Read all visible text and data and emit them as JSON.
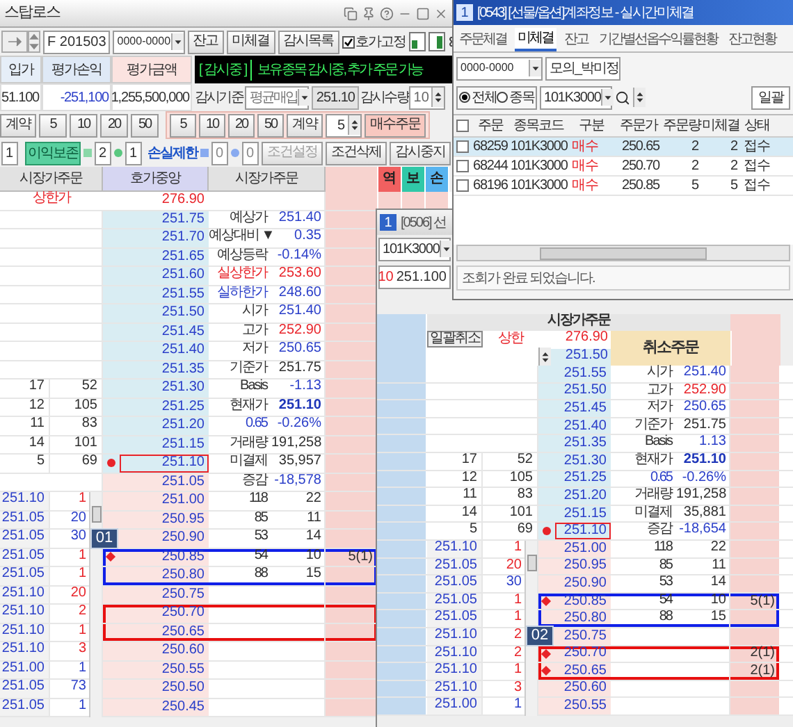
{
  "stoploss": {
    "title": "스탑로스",
    "toolbar": {
      "code": "F 201503",
      "account": "0000-0000",
      "buttons": [
        "잔고",
        "미체결",
        "감시목록"
      ],
      "fix_quote": {
        "label": "호가고정",
        "checked": true
      }
    },
    "summary": {
      "headers": [
        "입가",
        "평가손익",
        "평가금액"
      ],
      "values": [
        "51.100",
        "-251,100",
        "1,255,500,000"
      ],
      "status": "[ 감시중 ]",
      "message": "보유종목 감시중, 추가 주문 가능"
    },
    "watch": {
      "basis_label": "감시기준",
      "basis": "평균매입",
      "price": "251.10",
      "qty_label": "감시수량",
      "qty": "10"
    },
    "quick_left": {
      "label": "계약",
      "values": [
        "5",
        "10",
        "20",
        "50"
      ]
    },
    "quick_right": {
      "values": [
        "5",
        "10",
        "20",
        "50"
      ],
      "label": "계약",
      "qty": "5",
      "order": "매수주문"
    },
    "conditions": {
      "count": "1",
      "profit": {
        "label": "이익보존",
        "values": [
          "2",
          "1"
        ]
      },
      "loss": {
        "label": "손실제한",
        "values": [
          "0",
          "0"
        ]
      },
      "buttons": [
        {
          "label": "조건설정",
          "disabled": true
        },
        {
          "label": "조건삭제",
          "disabled": false
        },
        {
          "label": "감시중지",
          "disabled": false
        }
      ]
    },
    "book": {
      "columns": [
        "시장가주문",
        "호가중앙",
        "시장가주문"
      ],
      "flags": [
        {
          "label": "역",
          "color": "#f06060"
        },
        {
          "label": "보",
          "color": "#30c8a8"
        },
        {
          "label": "손",
          "color": "#58b4f0"
        }
      ],
      "rows": [
        {
          "kind": "limit",
          "price": "276.90",
          "limit_label": "상한가",
          "current": false
        },
        {
          "kind": "ask",
          "price": "251.75",
          "info": {
            "label": "예상가",
            "value": "251.40",
            "color": "#2b3fc9"
          },
          "current": false
        },
        {
          "kind": "ask",
          "price": "251.70",
          "info": {
            "label": "예상대비 ▼",
            "value": "0.35",
            "color": "#2b3fc9"
          },
          "current": false
        },
        {
          "kind": "ask",
          "price": "251.65",
          "info": {
            "label": "예상등락",
            "value": "-0.14%",
            "color": "#2b3fc9"
          },
          "current": false
        },
        {
          "kind": "ask",
          "price": "251.60",
          "info": {
            "label": "실상한가",
            "value": "253.60",
            "label_tone": {
              "color": "#e8242a"
            },
            "color": "#e8242a"
          },
          "current": false
        },
        {
          "kind": "ask",
          "price": "251.55",
          "info": {
            "label": "실하한가",
            "value": "248.60",
            "label_tone": {
              "color": "#2b3fc9"
            },
            "color": "#2b3fc9"
          },
          "current": false
        },
        {
          "kind": "ask",
          "price": "251.50",
          "info": {
            "label": "시가",
            "value": "251.40",
            "color": "#2b3fc9"
          },
          "current": false
        },
        {
          "kind": "ask",
          "price": "251.45",
          "info": {
            "label": "고가",
            "value": "252.90",
            "color": "#e8242a"
          },
          "current": false
        },
        {
          "kind": "ask",
          "price": "251.40",
          "info": {
            "label": "저가",
            "value": "250.65",
            "color": "#2b3fc9"
          },
          "current": false
        },
        {
          "kind": "ask",
          "price": "251.35",
          "info": {
            "label": "기준가",
            "value": "251.75",
            "color": "#303030"
          },
          "current": false
        },
        {
          "kind": "ask",
          "price": "251.30",
          "sell": [
            "17",
            "52"
          ],
          "info": {
            "label": "Basis",
            "value": "-1.13",
            "color": "#2b3fc9"
          },
          "current": false
        },
        {
          "kind": "ask",
          "price": "251.25",
          "sell": [
            "12",
            "105"
          ],
          "info": {
            "label": "현재가",
            "value": "251.10",
            "color": "#1d35b8",
            "bold": true
          },
          "current": false
        },
        {
          "kind": "ask",
          "price": "251.20",
          "sell": [
            "11",
            "83"
          ],
          "info": {
            "label": "0.65",
            "value": "-0.26%",
            "label_tone": {
              "color": "#2b3fc9"
            },
            "color": "#2b3fc9"
          },
          "current": false
        },
        {
          "kind": "ask",
          "price": "251.15",
          "sell": [
            "14",
            "101"
          ],
          "info": {
            "label": "거래량",
            "value": "191,258",
            "color": "#303030"
          },
          "current": false
        },
        {
          "kind": "ask",
          "price": "251.10",
          "sell": [
            "5",
            "69"
          ],
          "marker": {
            "kind": "dot"
          },
          "info": {
            "label": "미결제",
            "value": "35,957",
            "color": "#303030"
          },
          "current": true
        },
        {
          "kind": "bid",
          "price": "251.05",
          "info": {
            "label": "증감",
            "value": "-18,578",
            "color": "#2b3fc9"
          },
          "current": false
        },
        {
          "kind": "bid",
          "price": "251.00",
          "buy": {
            "price": "251.10",
            "qty": "1",
            "color": "#e8242a"
          },
          "info": {
            "label": "118",
            "value": "22",
            "color": "#303030"
          },
          "current": false
        },
        {
          "kind": "bid",
          "price": "250.95",
          "buy": {
            "price": "251.05",
            "qty": "20",
            "color": "#2b3fc9"
          },
          "info": {
            "label": "85",
            "value": "11",
            "color": "#303030"
          },
          "current": false
        },
        {
          "kind": "bid",
          "price": "250.90",
          "buy": {
            "price": "251.05",
            "qty": "30",
            "color": "#2b3fc9"
          },
          "info": {
            "label": "53",
            "value": "14",
            "color": "#303030"
          },
          "current": false
        },
        {
          "kind": "bid",
          "price": "250.85",
          "buy": {
            "price": "251.05",
            "qty": "1",
            "color": "#e8242a"
          },
          "marker": {
            "kind": "diamond"
          },
          "info": {
            "label": "54",
            "value": "10",
            "color": "#303030"
          },
          "order": "5(1)",
          "current": false,
          "highlight": {
            "color": "#1020e8"
          },
          "callout": "01"
        },
        {
          "kind": "bid",
          "price": "250.80",
          "buy": {
            "price": "251.05",
            "qty": "1",
            "color": "#e8242a"
          },
          "info": {
            "label": "88",
            "value": "15",
            "color": "#303030"
          },
          "current": false,
          "highlight": {
            "color": "#1020e8"
          }
        },
        {
          "kind": "bid",
          "price": "250.75",
          "buy": {
            "price": "251.10",
            "qty": "20",
            "color": "#e8242a"
          },
          "current": false
        },
        {
          "kind": "bid",
          "price": "250.70",
          "buy": {
            "price": "251.10",
            "qty": "2",
            "color": "#e8242a"
          },
          "current": false,
          "highlight": {
            "color": "#e81010"
          }
        },
        {
          "kind": "bid",
          "price": "250.65",
          "buy": {
            "price": "251.10",
            "qty": "1",
            "color": "#e8242a"
          },
          "current": false,
          "highlight": {
            "color": "#e81010"
          }
        },
        {
          "kind": "bid",
          "price": "250.60",
          "buy": {
            "price": "251.10",
            "qty": "3",
            "color": "#e8242a"
          },
          "current": false
        },
        {
          "kind": "bid",
          "price": "250.55",
          "buy": {
            "price": "251.00",
            "qty": "1",
            "color": "#2b3fc9"
          },
          "current": false
        },
        {
          "kind": "bid",
          "price": "250.50",
          "buy": {
            "price": "251.05",
            "qty": "73",
            "color": "#2b3fc9"
          },
          "current": false
        },
        {
          "kind": "bid",
          "price": "250.45",
          "buy": {
            "price": "251.05",
            "qty": "1",
            "color": "#2b3fc9"
          },
          "current": false
        }
      ]
    }
  },
  "futures_window": {
    "badge": "1",
    "title": "[0506] 선",
    "code": "101K3000",
    "qty": "10",
    "price": "251.100",
    "book": {
      "header": "시장가주문",
      "cancel_all": "일괄취소",
      "upper_label": "상한",
      "upper_price": "276.90",
      "price_field": "251.50",
      "cancel_order": "취소주문",
      "rows": [
        {
          "kind": "ask",
          "price": "251.55",
          "info": {
            "label": "시가",
            "value": "251.40",
            "color": "#2b3fc9"
          },
          "current": false
        },
        {
          "kind": "ask",
          "price": "251.50",
          "info": {
            "label": "고가",
            "value": "252.90",
            "color": "#e8242a"
          },
          "current": false
        },
        {
          "kind": "ask",
          "price": "251.45",
          "info": {
            "label": "저가",
            "value": "250.65",
            "color": "#2b3fc9"
          },
          "current": false
        },
        {
          "kind": "ask",
          "price": "251.40",
          "info": {
            "label": "기준가",
            "value": "251.75",
            "color": "#303030"
          },
          "current": false
        },
        {
          "kind": "ask",
          "price": "251.35",
          "info": {
            "label": "Basis",
            "value": "1.13",
            "color": "#2b3fc9"
          },
          "current": false
        },
        {
          "kind": "ask",
          "price": "251.30",
          "sell": [
            "17",
            "52"
          ],
          "info": {
            "label": "현재가",
            "value": "251.10",
            "color": "#1d35b8",
            "bold": true
          },
          "current": false
        },
        {
          "kind": "ask",
          "price": "251.25",
          "sell": [
            "12",
            "105"
          ],
          "info": {
            "label": "0.65",
            "value": "-0.26%",
            "label_tone": {
              "color": "#2b3fc9"
            },
            "color": "#2b3fc9"
          },
          "current": false
        },
        {
          "kind": "ask",
          "price": "251.20",
          "sell": [
            "11",
            "83"
          ],
          "info": {
            "label": "거래량",
            "value": "191,258",
            "color": "#303030"
          },
          "current": false
        },
        {
          "kind": "ask",
          "price": "251.15",
          "sell": [
            "14",
            "101"
          ],
          "info": {
            "label": "미결제",
            "value": "35,881",
            "color": "#303030"
          },
          "current": false
        },
        {
          "kind": "ask",
          "price": "251.10",
          "sell": [
            "5",
            "69"
          ],
          "marker": {
            "kind": "dot"
          },
          "info": {
            "label": "증감",
            "value": "-18,654",
            "color": "#2b3fc9"
          },
          "current": true
        },
        {
          "kind": "bid",
          "price": "251.00",
          "buy": {
            "price": "251.10",
            "qty": "1",
            "color": "#e8242a"
          },
          "info": {
            "label": "118",
            "value": "22",
            "color": "#303030"
          },
          "current": false
        },
        {
          "kind": "bid",
          "price": "250.95",
          "buy": {
            "price": "251.05",
            "qty": "20",
            "color": "#e8242a"
          },
          "info": {
            "label": "85",
            "value": "11",
            "color": "#303030"
          },
          "current": false
        },
        {
          "kind": "bid",
          "price": "250.90",
          "buy": {
            "price": "251.05",
            "qty": "30",
            "color": "#2b3fc9"
          },
          "info": {
            "label": "53",
            "value": "14",
            "color": "#303030"
          },
          "current": false
        },
        {
          "kind": "bid",
          "price": "250.85",
          "buy": {
            "price": "251.05",
            "qty": "1",
            "color": "#e8242a"
          },
          "marker": {
            "kind": "diamond"
          },
          "info": {
            "label": "54",
            "value": "10",
            "color": "#303030"
          },
          "order": "5(1)",
          "current": false,
          "highlight": {
            "color": "#1020e8"
          }
        },
        {
          "kind": "bid",
          "price": "250.80",
          "buy": {
            "price": "251.05",
            "qty": "1",
            "color": "#e8242a"
          },
          "info": {
            "label": "88",
            "value": "15",
            "color": "#303030"
          },
          "current": false,
          "highlight": {
            "color": "#1020e8"
          }
        },
        {
          "kind": "bid",
          "price": "250.75",
          "buy": {
            "price": "251.10",
            "qty": "2",
            "color": "#e8242a"
          },
          "current": false
        },
        {
          "kind": "bid",
          "price": "250.70",
          "buy": {
            "price": "251.10",
            "qty": "2",
            "color": "#e8242a"
          },
          "marker": {
            "kind": "diamond"
          },
          "order": "2(1)",
          "current": false,
          "highlight": {
            "color": "#e81010"
          },
          "callout": "02"
        },
        {
          "kind": "bid",
          "price": "250.65",
          "buy": {
            "price": "251.10",
            "qty": "1",
            "color": "#e8242a"
          },
          "marker": {
            "kind": "diamond"
          },
          "order": "2(1)",
          "current": false,
          "highlight": {
            "color": "#e81010"
          }
        },
        {
          "kind": "bid",
          "price": "250.60",
          "buy": {
            "price": "251.10",
            "qty": "3",
            "color": "#e8242a"
          },
          "current": false
        },
        {
          "kind": "bid",
          "price": "250.55",
          "buy": {
            "price": "251.00",
            "qty": "1",
            "color": "#2b3fc9"
          },
          "current": false
        }
      ]
    }
  },
  "account_window": {
    "badge": "1",
    "title": "[0543] [선물/옵션]계좌정보 - 실시간미체결",
    "tabs": [
      {
        "label": "주문체결",
        "selected": false
      },
      {
        "label": "미체결",
        "selected": true
      },
      {
        "label": "잔고",
        "selected": false
      },
      {
        "label": "기간별선옵수익률현황",
        "selected": false
      },
      {
        "label": "잔고현황",
        "selected": false
      }
    ],
    "account": "0000-0000",
    "owner": "모의_박미정",
    "filters": [
      {
        "label": "전체",
        "selected": true
      },
      {
        "label": "종목",
        "selected": false
      }
    ],
    "code": "101K3000",
    "action": "일괄",
    "table": {
      "checked": false,
      "columns": [
        "주문",
        "종목코드",
        "구분",
        "주문가",
        "주문량",
        "미체결",
        "상태"
      ],
      "rows": [
        {
          "cells": [
            "68259",
            "101K3000",
            "매수",
            "250.65",
            "2",
            "2",
            "접수"
          ],
          "selected": true,
          "checked": false
        },
        {
          "cells": [
            "68244",
            "101K3000",
            "매수",
            "250.70",
            "2",
            "2",
            "접수"
          ],
          "selected": false,
          "checked": false
        },
        {
          "cells": [
            "68196",
            "101K3000",
            "매수",
            "250.85",
            "5",
            "5",
            "접수"
          ],
          "selected": false,
          "checked": false
        }
      ]
    },
    "status": "조회가 완료 되었습니다."
  }
}
